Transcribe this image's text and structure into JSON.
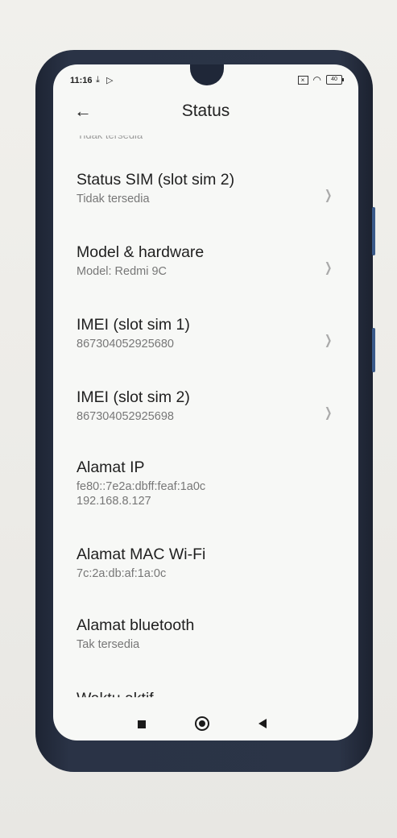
{
  "status_bar": {
    "time": "11:16",
    "left_icons": [
      "download-icon",
      "play-store-icon"
    ],
    "right_icons": [
      "sim-off-icon",
      "wifi-icon",
      "battery-icon"
    ],
    "battery_level": "40"
  },
  "header": {
    "title": "Status",
    "back_icon": "arrow-left-icon"
  },
  "partial_top_text": "Tidak tersedia",
  "items": [
    {
      "title": "Status SIM (slot sim 2)",
      "subtitle": "Tidak tersedia",
      "has_chevron": true
    },
    {
      "title": "Model & hardware",
      "subtitle": "Model: Redmi 9C",
      "has_chevron": true
    },
    {
      "title": "IMEI (slot sim 1)",
      "subtitle": "867304052925680",
      "has_chevron": true
    },
    {
      "title": "IMEI (slot sim 2)",
      "subtitle": "867304052925698",
      "has_chevron": true
    },
    {
      "title": "Alamat IP",
      "subtitle": "fe80::7e2a:dbff:feaf:1a0c",
      "subtitle2": "192.168.8.127",
      "has_chevron": false
    },
    {
      "title": "Alamat MAC Wi-Fi",
      "subtitle": "7c:2a:db:af:1a:0c",
      "has_chevron": false
    },
    {
      "title": "Alamat bluetooth",
      "subtitle": "Tak tersedia",
      "has_chevron": false
    }
  ],
  "partial_bottom_text": "Waktu aktif",
  "navbar": [
    "recents-button",
    "home-button",
    "back-button"
  ]
}
